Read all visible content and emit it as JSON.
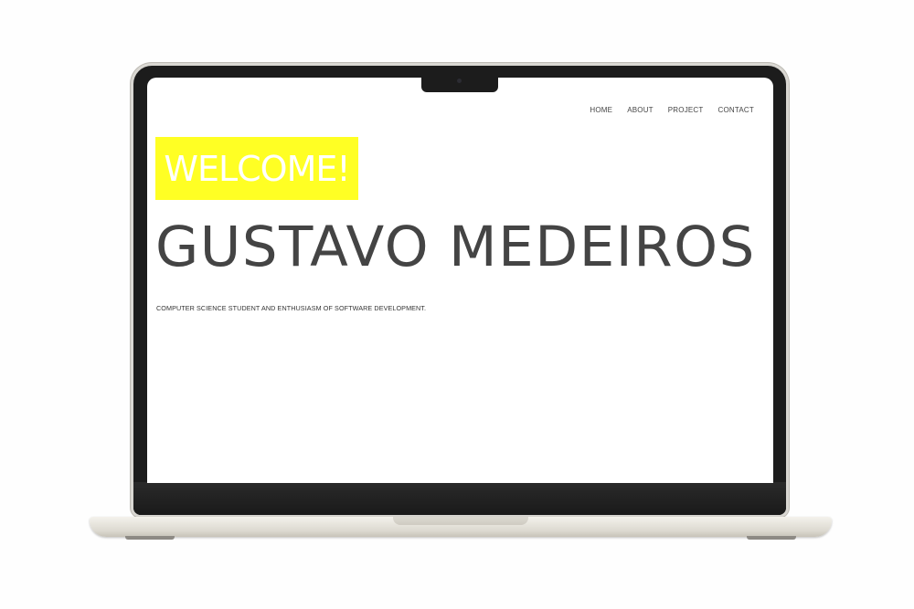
{
  "nav": {
    "items": [
      {
        "label": "HOME"
      },
      {
        "label": "ABOUT"
      },
      {
        "label": "PROJECT"
      },
      {
        "label": "CONTACT"
      }
    ]
  },
  "hero": {
    "welcome": "WELCOME!",
    "name": "GUSTAVO MEDEIROS",
    "subtitle": "COMPUTER SCIENCE STUDENT AND ENTHUSIASM OF SOFTWARE DEVELOPMENT."
  },
  "colors": {
    "welcome_background": "#ffff24",
    "welcome_text": "#ffffff",
    "name_text": "#444444",
    "nav_text": "#444444",
    "laptop_bezel": "#1c1c1c",
    "laptop_body": "#dcd9d0"
  }
}
